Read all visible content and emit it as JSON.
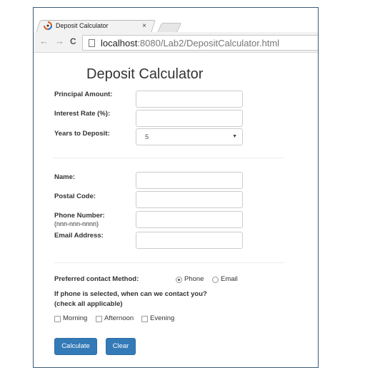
{
  "browser": {
    "tab_title": "Deposit Calculator",
    "tab_close": "×",
    "back": "←",
    "forward": "→",
    "reload": "C",
    "url_host": "localhost",
    "url_rest": ":8080/Lab2/DepositCalculator.html"
  },
  "page": {
    "title": "Deposit Calculator",
    "principal_label": "Principal Amount:",
    "principal_value": "",
    "interest_label": "Interest Rate (%):",
    "interest_value": "",
    "years_label": "Years to Deposit:",
    "years_value": "5",
    "name_label": "Name:",
    "postal_label": "Postal Code:",
    "phone_label": "Phone Number:",
    "phone_hint": "(nnn-nnn-nnnn)",
    "email_label": "Email Address:",
    "contact_label": "Preferred contact Method:",
    "contact_options": [
      "Phone",
      "Email"
    ],
    "contact_selected": "Phone",
    "when_label": "If phone is selected, when can we contact you?",
    "when_hint": "(check all applicable)",
    "time_options": [
      "Morning",
      "Afternoon",
      "Evening"
    ],
    "calculate_label": "Calculate",
    "clear_label": "Clear"
  },
  "colors": {
    "button": "#337ab7",
    "frame_border": "#3a5a78"
  }
}
